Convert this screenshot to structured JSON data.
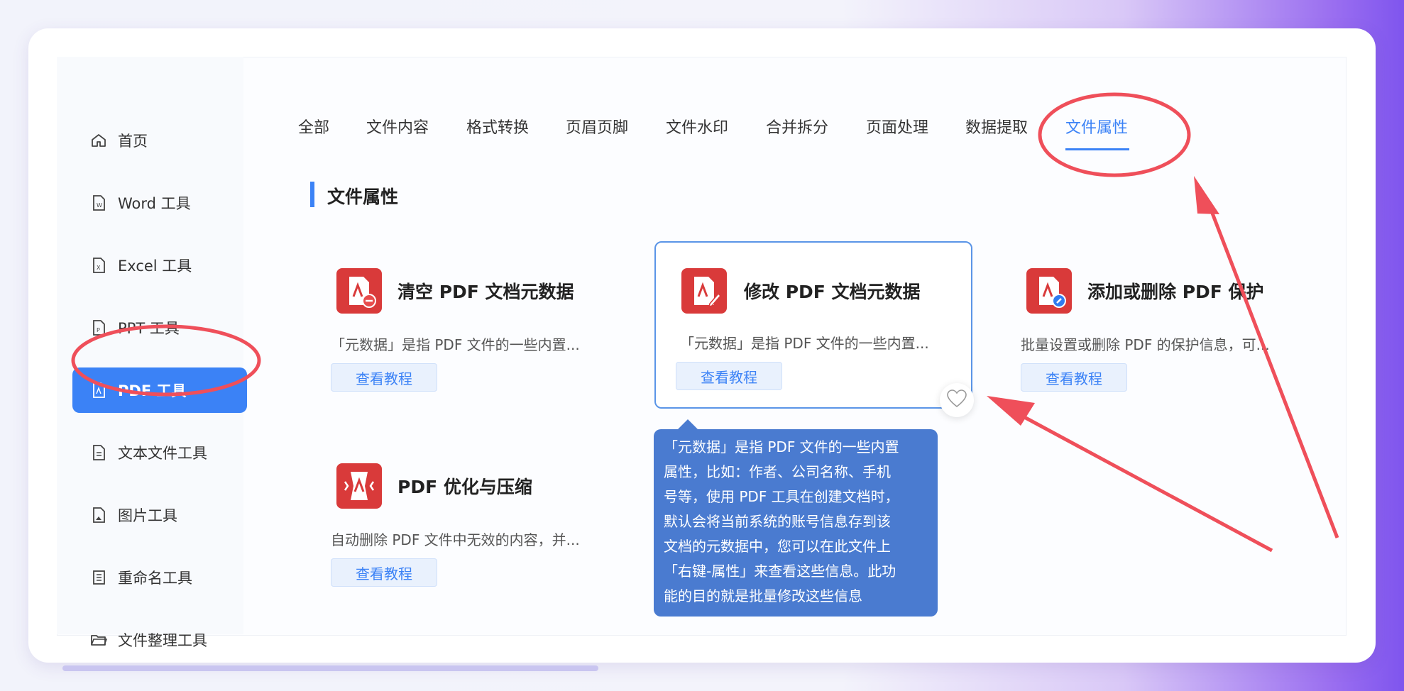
{
  "sidebar": {
    "items": [
      {
        "label": "首页",
        "icon": "home-icon"
      },
      {
        "label": "Word 工具",
        "icon": "word-file-icon"
      },
      {
        "label": "Excel 工具",
        "icon": "excel-file-icon"
      },
      {
        "label": "PPT 工具",
        "icon": "ppt-file-icon"
      },
      {
        "label": "PDF 工具",
        "icon": "pdf-file-icon",
        "active": true
      },
      {
        "label": "文本文件工具",
        "icon": "text-file-icon"
      },
      {
        "label": "图片工具",
        "icon": "image-file-icon"
      },
      {
        "label": "重命名工具",
        "icon": "rename-icon"
      },
      {
        "label": "文件整理工具",
        "icon": "folder-icon"
      }
    ]
  },
  "tabs": [
    "全部",
    "文件内容",
    "格式转换",
    "页眉页脚",
    "文件水印",
    "合并拆分",
    "页面处理",
    "数据提取",
    "文件属性"
  ],
  "active_tab": "文件属性",
  "section": {
    "title": "文件属性"
  },
  "tools": [
    {
      "name": "清空 PDF 文档元数据",
      "desc": "「元数据」是指 PDF 文件的一些内置...",
      "button": "查看教程",
      "icon": "pdf-clear-icon"
    },
    {
      "name": "修改 PDF 文档元数据",
      "desc": "「元数据」是指 PDF 文件的一些内置...",
      "button": "查看教程",
      "icon": "pdf-edit-icon"
    },
    {
      "name": "添加或删除 PDF 保护",
      "desc": "批量设置或删除 PDF 的保护信息，可...",
      "button": "查看教程",
      "icon": "pdf-lock-icon"
    },
    {
      "name": "PDF 优化与压缩",
      "desc": "自动删除 PDF 文件中无效的内容，并...",
      "button": "查看教程",
      "icon": "pdf-compress-icon"
    }
  ],
  "tooltip": {
    "lines": [
      "「元数据」是指 PDF 文件的一些内置",
      "属性，比如：作者、公司名称、手机",
      "号等，使用 PDF 工具在创建文档时，",
      "默认会将当前系统的账号信息存到该",
      "文档的元数据中，您可以在此文件上",
      "「右键-属性」来查看这些信息。此功",
      "能的目的就是批量修改这些信息"
    ]
  },
  "colors": {
    "accent": "#3b82f6",
    "tool_icon": "#d93a3a",
    "annotation": "#ef4f5a",
    "tooltip_bg": "#4a7bd0"
  }
}
